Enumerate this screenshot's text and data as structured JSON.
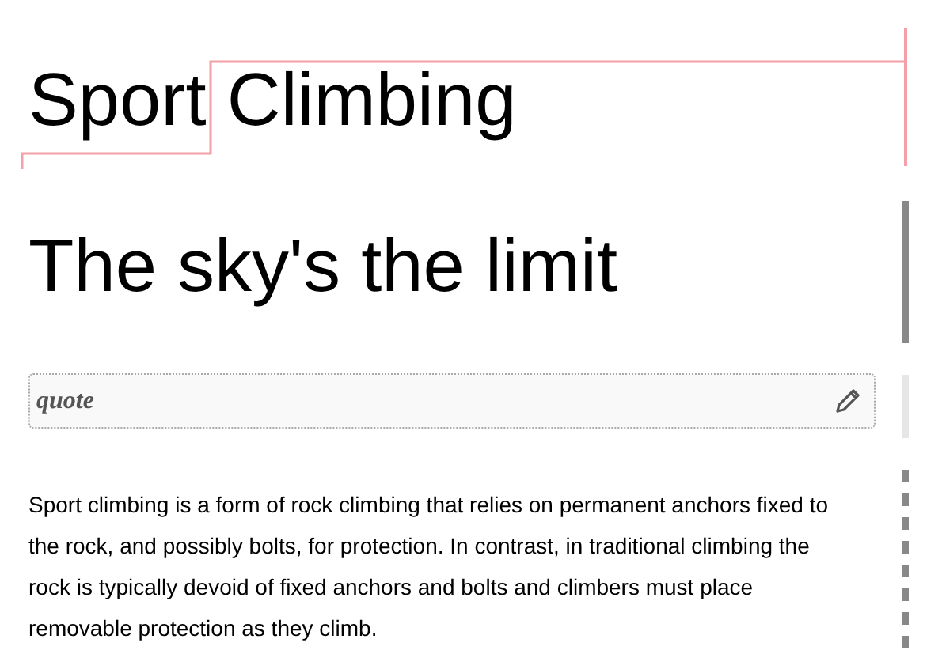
{
  "blocks": [
    {
      "kind": "heading1",
      "text": "Sport Climbing",
      "selected": true
    },
    {
      "kind": "heading2",
      "text": "The sky's the limit",
      "selected": false
    },
    {
      "kind": "quote",
      "placeholder": "quote",
      "selected": false
    },
    {
      "kind": "paragraph",
      "text": "Sport climbing is a form of rock climbing that relies on permanent anchors fixed to the rock, and possibly bolts, for protection. In contrast, in traditional climbing the rock is typically devoid of fixed anchors and bolts and climbers must place removable protection as they climb.",
      "selected": false
    }
  ]
}
